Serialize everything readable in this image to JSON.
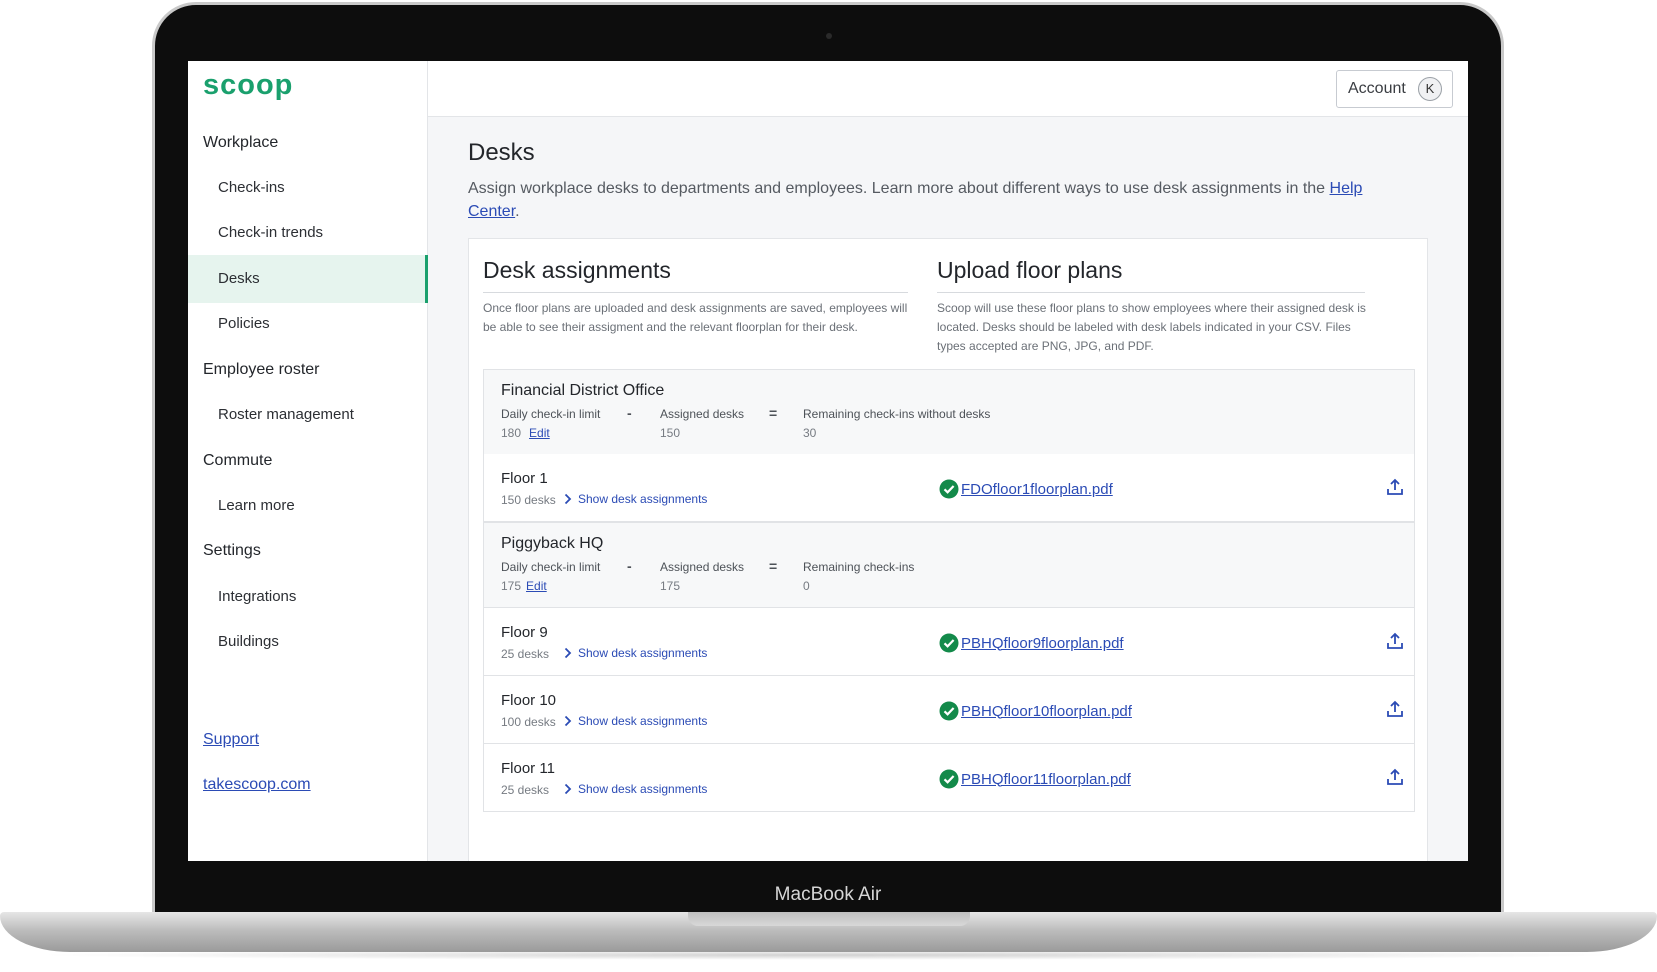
{
  "device_label": "MacBook Air",
  "brand": {
    "logo": "scoop",
    "accent": "#1aa06d",
    "link_color": "#2b4bb5"
  },
  "sidebar": {
    "sections": [
      {
        "heading": "Workplace",
        "items": [
          "Check-ins",
          "Check-in trends",
          "Desks",
          "Policies"
        ]
      },
      {
        "heading": "Employee roster",
        "items": [
          "Roster management"
        ]
      },
      {
        "heading": "Commute",
        "items": [
          "Learn more"
        ]
      },
      {
        "heading": "Settings",
        "items": [
          "Integrations",
          "Buildings"
        ]
      }
    ],
    "active_item": "Desks",
    "footer_links": [
      "Support",
      "takescoop.com"
    ]
  },
  "topbar": {
    "account_label": "Account",
    "avatar_initial": "K"
  },
  "page": {
    "title": "Desks",
    "description": "Assign workplace desks to departments and employees. Learn more about different ways to use desk assignments in the ",
    "help_link": "Help Center",
    "description_end": "."
  },
  "desk_assignments": {
    "title": "Desk assignments",
    "text": "Once floor plans are uploaded and desk assignments are saved, employees will be able to see their assigment and the relevant floorplan for their desk."
  },
  "upload_floor_plans": {
    "title": "Upload floor plans",
    "text": "Scoop will use these floor plans to show employees where their assigned desk is located. Desks should be labeled with desk labels indicated in your CSV. Files types accepted are PNG, JPG, and PDF."
  },
  "buildings": [
    {
      "name": "Financial District Office",
      "limit_label": "Daily check-in limit",
      "limit_value": "180",
      "edit_label": "Edit",
      "minus": "-",
      "assigned_label": "Assigned desks",
      "assigned_value": "150",
      "equals": "=",
      "remaining_label": "Remaining check-ins without desks",
      "remaining_value": "30",
      "floors": [
        {
          "name": "Floor 1",
          "count": "150 desks",
          "link": "Show desk assignments",
          "file": "FDOfloor1floorplan.pdf"
        }
      ]
    },
    {
      "name": "Piggyback HQ",
      "limit_label": "Daily check-in limit",
      "limit_value": "175",
      "edit_label": "Edit",
      "minus": "-",
      "assigned_label": "Assigned desks",
      "assigned_value": "175",
      "equals": "=",
      "remaining_label": "Remaining check-ins",
      "remaining_value": "0",
      "floors": [
        {
          "name": "Floor 9",
          "count": "25 desks",
          "link": "Show desk assignments",
          "file": "PBHQfloor9floorplan.pdf"
        },
        {
          "name": "Floor 10",
          "count": "100 desks",
          "link": "Show desk assignments",
          "file": "PBHQfloor10floorplan.pdf"
        },
        {
          "name": "Floor 11",
          "count": "25 desks",
          "link": "Show desk assignments",
          "file": "PBHQfloor11floorplan.pdf"
        }
      ]
    }
  ],
  "icons": {
    "file_status": "check-circle-icon",
    "upload": "upload-icon",
    "expand": "chevron-right-icon"
  }
}
